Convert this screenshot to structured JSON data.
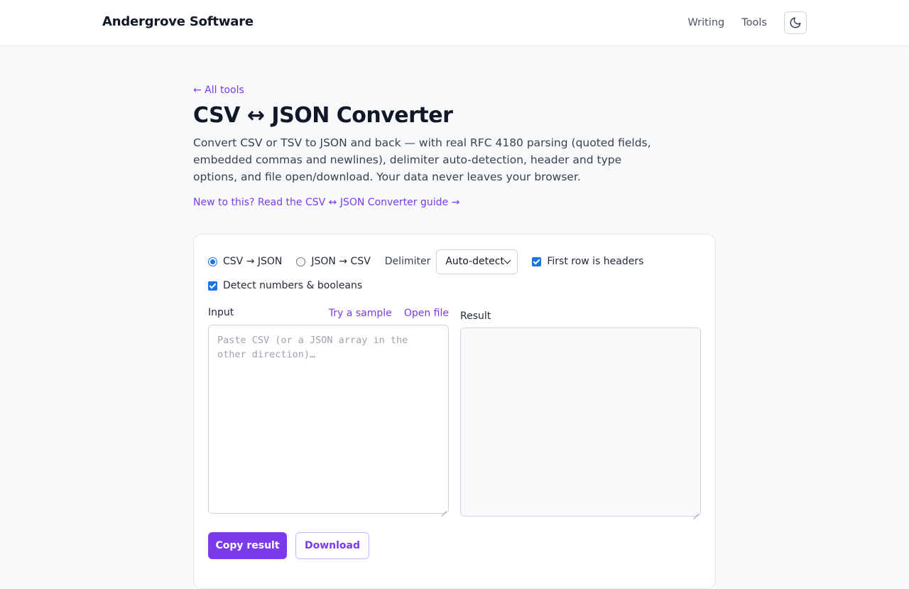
{
  "header": {
    "brand": "Andergrove Software",
    "nav": [
      {
        "label": "Writing"
      },
      {
        "label": "Tools"
      }
    ],
    "theme_toggle_icon": "moon-icon"
  },
  "page": {
    "back_link": "← All tools",
    "title": "CSV ↔ JSON Converter",
    "description": "Convert CSV or TSV to JSON and back — with real RFC 4180 parsing (quoted fields, embedded commas and newlines), delimiter auto-detection, header and type options, and file open/download. Your data never leaves your browser.",
    "guide_link": "New to this? Read the CSV ↔ JSON Converter guide →"
  },
  "converter": {
    "modes": [
      {
        "label": "CSV → JSON",
        "selected": true
      },
      {
        "label": "JSON → CSV",
        "selected": false
      }
    ],
    "delimiter_label": "Delimiter",
    "delimiter_value": "Auto-detect",
    "headers_checkbox": {
      "label": "First row is headers",
      "checked": true
    },
    "detect_types_checkbox": {
      "label": "Detect numbers & booleans",
      "checked": true
    },
    "input_label": "Input",
    "sample_link": "Try a sample",
    "open_file_link": "Open file",
    "input_placeholder": "Paste CSV (or a JSON array in the other direction)…",
    "input_value": "",
    "result_label": "Result",
    "result_value": "",
    "copy_button": "Copy result",
    "download_button": "Download"
  },
  "colors": {
    "accent": "#7c3aed",
    "checkbox": "#1a73e8"
  }
}
